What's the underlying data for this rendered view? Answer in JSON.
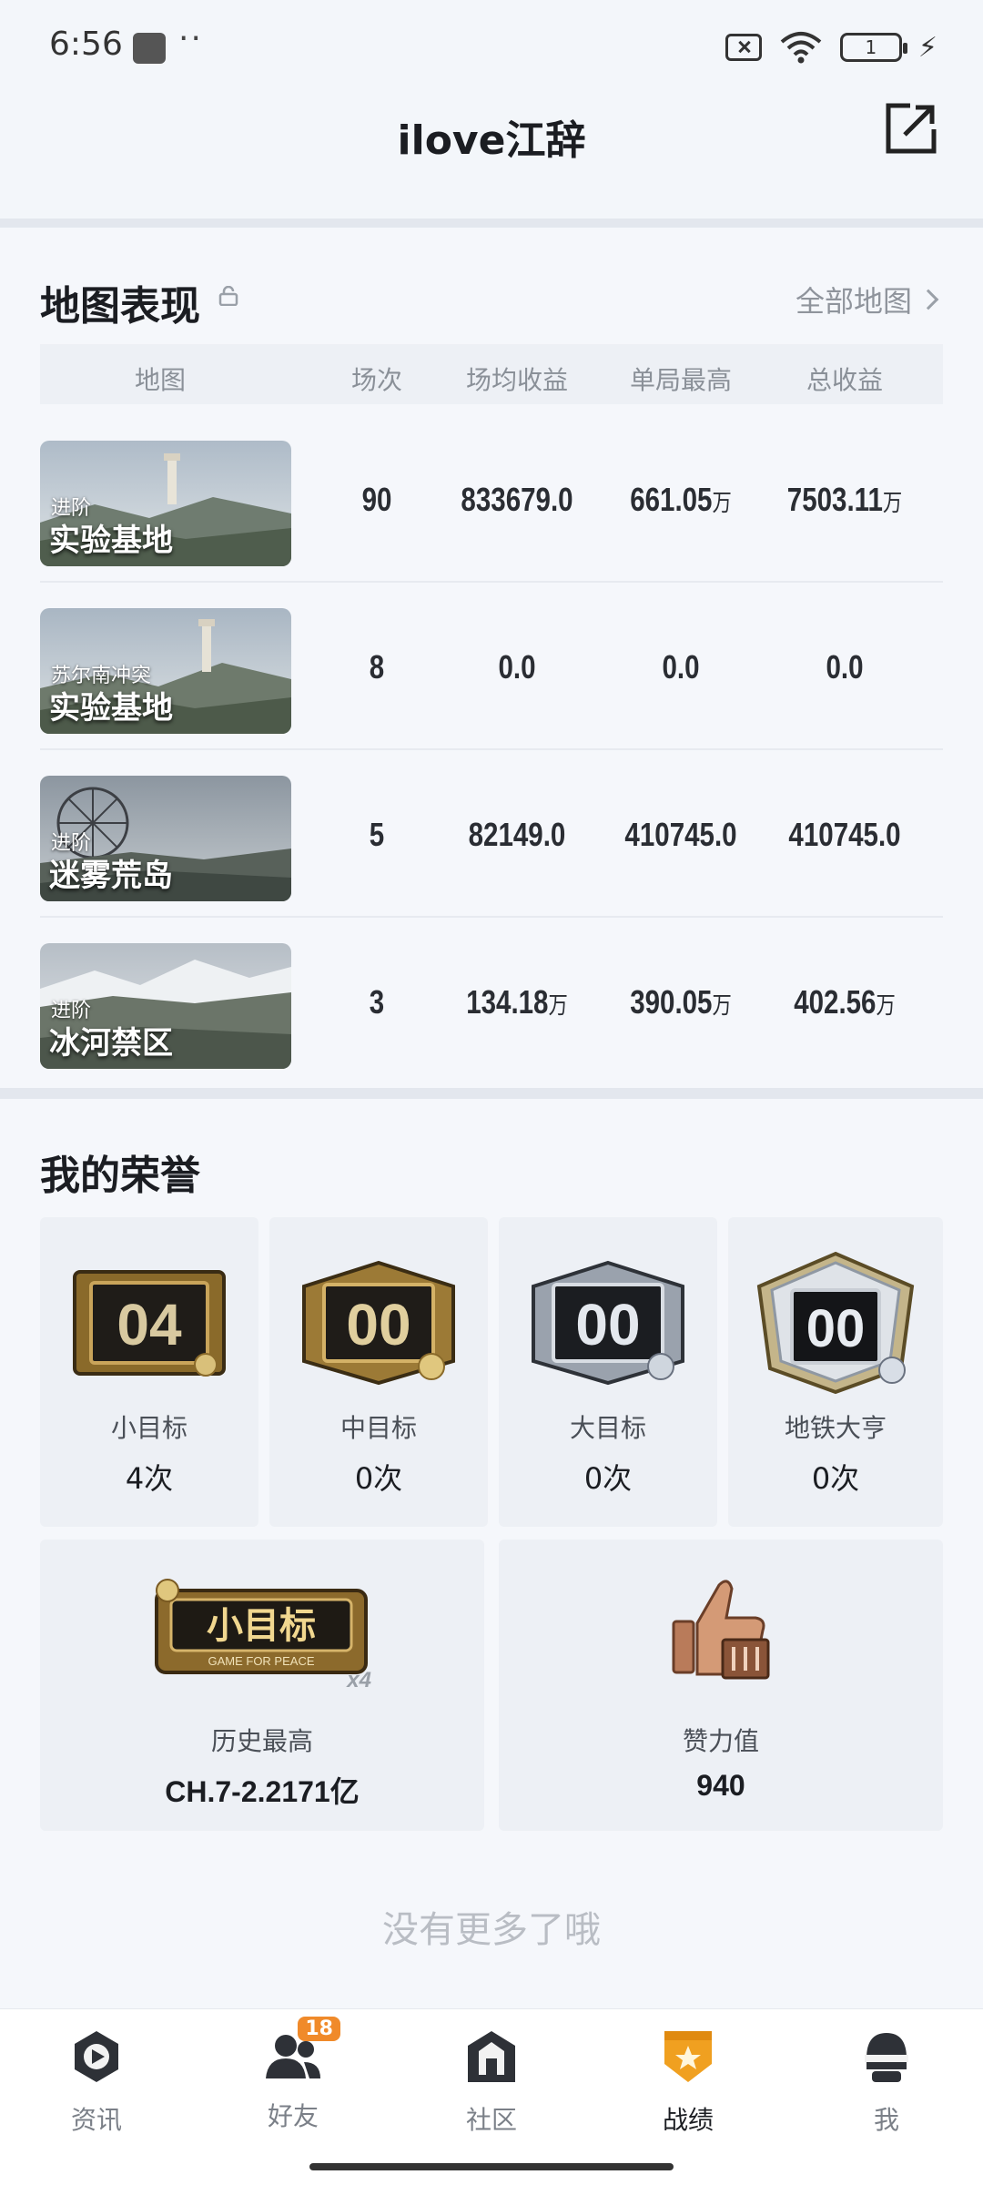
{
  "status_bar": {
    "time": "6:56",
    "dots": "··",
    "battery": "1",
    "bolt": "⚡"
  },
  "header": {
    "title": "ilove江辞"
  },
  "map_section": {
    "title": "地图表现",
    "all_maps_label": "全部地图",
    "columns": [
      "地图",
      "场次",
      "场均收益",
      "单局最高",
      "总收益"
    ],
    "rows": [
      {
        "mode": "进阶",
        "name": "实验基地",
        "matches": "90",
        "avg": "833679.0",
        "avg_unit": "",
        "best": "661.05",
        "best_unit": "万",
        "total": "7503.11",
        "total_unit": "万"
      },
      {
        "mode": "苏尔南冲突",
        "name": "实验基地",
        "matches": "8",
        "avg": "0.0",
        "avg_unit": "",
        "best": "0.0",
        "best_unit": "",
        "total": "0.0",
        "total_unit": ""
      },
      {
        "mode": "进阶",
        "name": "迷雾荒岛",
        "matches": "5",
        "avg": "82149.0",
        "avg_unit": "",
        "best": "410745.0",
        "best_unit": "",
        "total": "410745.0",
        "total_unit": ""
      },
      {
        "mode": "进阶",
        "name": "冰河禁区",
        "matches": "3",
        "avg": "134.18",
        "avg_unit": "万",
        "best": "390.05",
        "best_unit": "万",
        "total": "402.56",
        "total_unit": "万"
      }
    ]
  },
  "honor_section": {
    "title": "我的荣誉",
    "badges": [
      {
        "number": "04",
        "label": "小目标",
        "value": "4次"
      },
      {
        "number": "00",
        "label": "中目标",
        "value": "0次"
      },
      {
        "number": "00",
        "label": "大目标",
        "value": "0次"
      },
      {
        "number": "00",
        "label": "地铁大亨",
        "value": "0次"
      }
    ],
    "history": {
      "badge_text": "小目标",
      "badge_sub": "GAME FOR PEACE",
      "multiplier": "x4",
      "label": "历史最高",
      "value": "CH.7-2.2171亿"
    },
    "likes": {
      "label": "赞力值",
      "value": "940"
    },
    "no_more": "没有更多了哦"
  },
  "bottom_nav": {
    "items": [
      {
        "label": "资讯",
        "icon": "news-icon"
      },
      {
        "label": "好友",
        "icon": "friends-icon",
        "badge": "18"
      },
      {
        "label": "社区",
        "icon": "community-icon"
      },
      {
        "label": "战绩",
        "icon": "record-icon",
        "active": true
      },
      {
        "label": "我",
        "icon": "profile-icon"
      }
    ]
  },
  "colors": {
    "accent": "#f0a020",
    "badge": "#f08a2a",
    "background": "#f3f6fa"
  }
}
